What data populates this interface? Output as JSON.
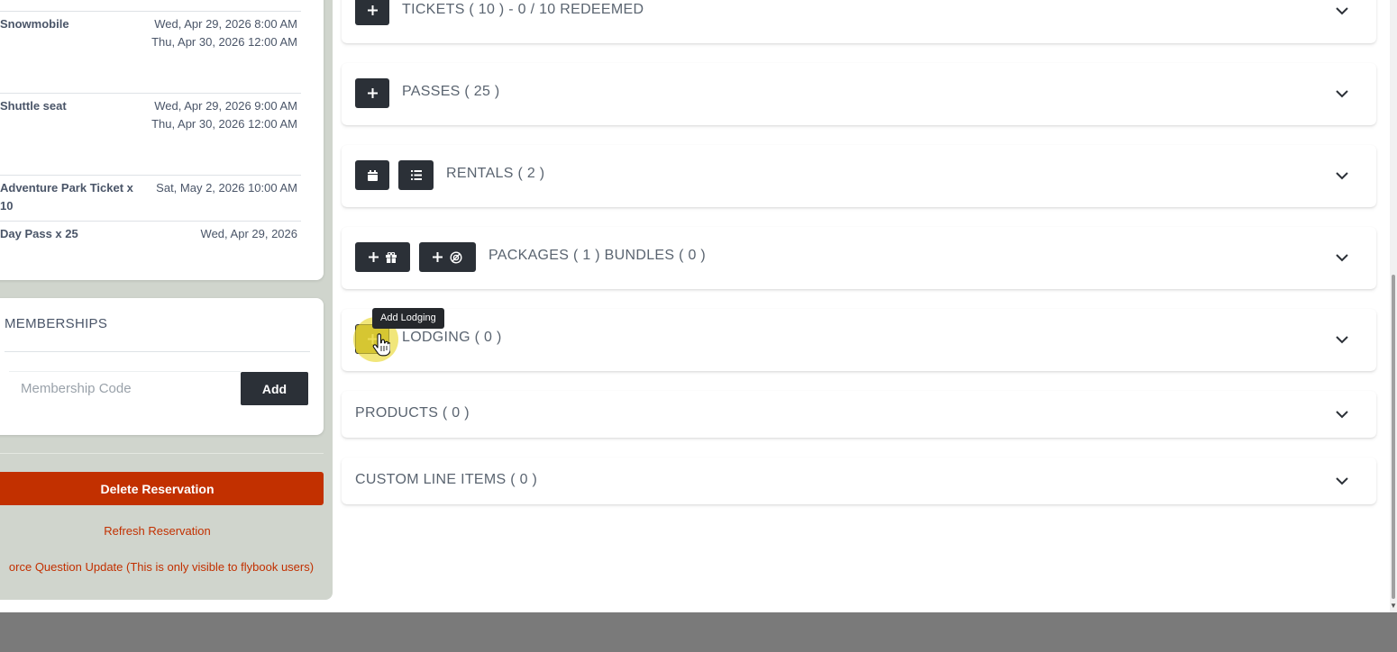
{
  "sidebar": {
    "items": [
      {
        "name": "Snowmobile",
        "dates": [
          "Wed, Apr 29, 2026 8:00 AM",
          "Thu, Apr 30, 2026 12:00 AM"
        ]
      },
      {
        "name": "Shuttle seat",
        "dates": [
          "Wed, Apr 29, 2026 9:00 AM",
          "Thu, Apr 30, 2026 12:00 AM"
        ]
      },
      {
        "name": "Adventure Park Ticket x 10",
        "dates": [
          "Sat, May 2, 2026 10:00 AM"
        ]
      },
      {
        "name": "Day Pass x 25",
        "dates": [
          "Wed, Apr 29, 2026"
        ]
      }
    ],
    "memberships": {
      "title": "MEMBERSHIPS",
      "code_placeholder": "Membership Code",
      "code_value": "",
      "add_label": "Add"
    },
    "delete_label": "Delete Reservation",
    "refresh_label": "Refresh Reservation",
    "force_label": "orce Question Update (This is only visible to flybook users)"
  },
  "sections": {
    "tickets": "TICKETS ( 10 ) - 0 / 10 REDEEMED",
    "passes": "PASSES ( 25 )",
    "rentals": "RENTALS ( 2 )",
    "packages": "PACKAGES ( 1 ) BUNDLES ( 0 )",
    "lodging": "LODGING ( 0 )",
    "products": "PRODUCTS ( 0 )",
    "custom_line_items": "CUSTOM LINE ITEMS ( 0 )"
  },
  "tooltip": "Add Lodging",
  "icons": {
    "add": "plus-icon",
    "calendar": "calendar-icon",
    "list": "list-icon",
    "gift": "gift-icon",
    "bundle": "bundle-icon",
    "expand": "chevron-down-icon",
    "cursor": "hand-pointer-icon"
  },
  "colors": {
    "dark_button": "#2b3037",
    "danger": "#c23000",
    "sidebar_bg": "#d0d5cd",
    "lodging_highlight": "#b3a333"
  }
}
